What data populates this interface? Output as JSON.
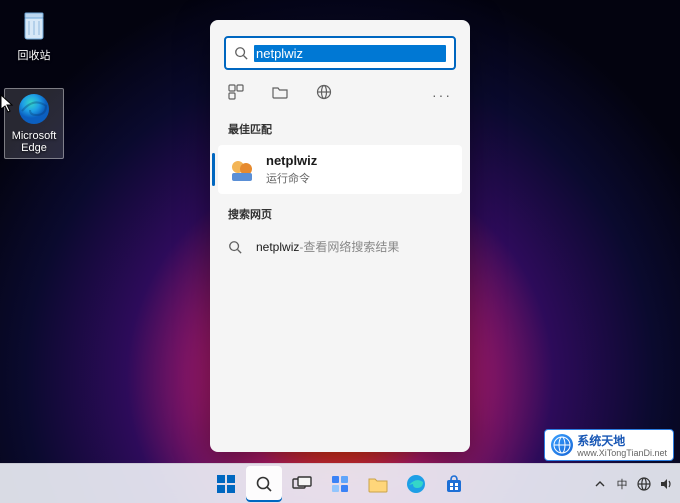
{
  "desktop": {
    "recycle_bin_label": "回收站",
    "edge_label": "Microsoft Edge"
  },
  "search": {
    "query": "netplwiz",
    "best_match_header": "最佳匹配",
    "best_match": {
      "title": "netplwiz",
      "subtitle": "运行命令"
    },
    "web_header": "搜索网页",
    "web_result": {
      "query": "netplwiz",
      "separator": " - ",
      "hint": "查看网络搜索结果"
    }
  },
  "filter_icons": {
    "apps": "apps-icon",
    "documents": "folder-icon",
    "web": "web-icon",
    "more": "···"
  },
  "taskbar": {
    "ime": "中"
  },
  "watermark": {
    "title": "系统天地",
    "url": "www.XiTongTianDi.net"
  }
}
